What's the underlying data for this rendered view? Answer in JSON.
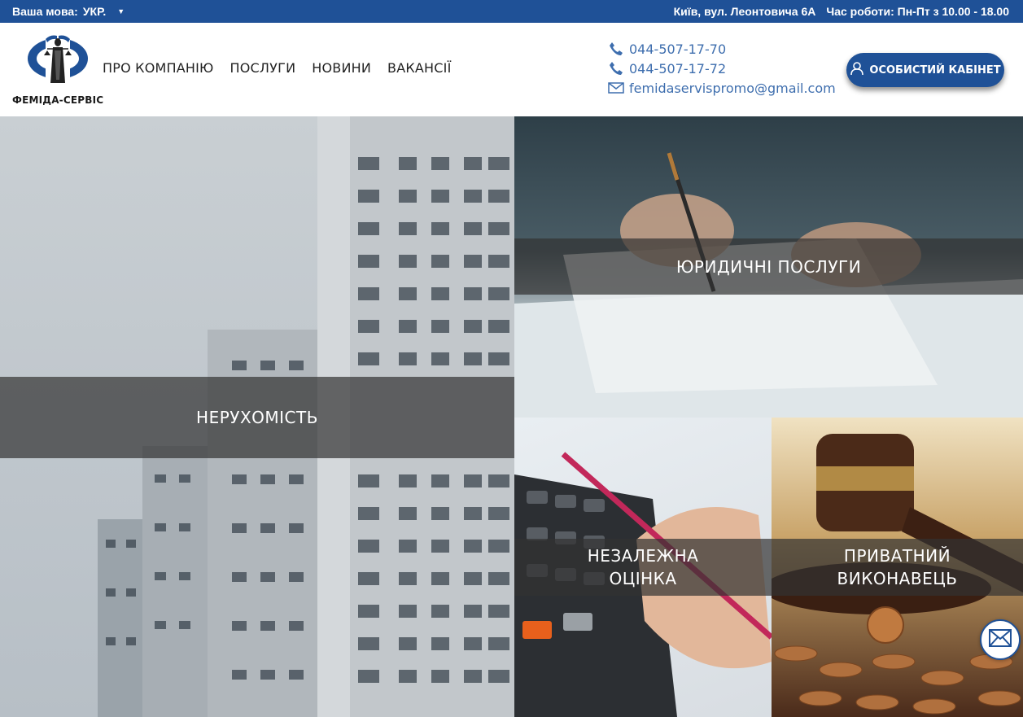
{
  "topbar": {
    "language_label": "Ваша мова:",
    "language_value": "УКР.",
    "address": "Київ, вул. Леонтовича 6А",
    "hours": "Час роботи: Пн-Пт з 10.00 - 18.00"
  },
  "header": {
    "brand": "ФЕМІДА-СЕРВІС",
    "nav": [
      "ПРО КОМПАНІЮ",
      "ПОСЛУГИ",
      "НОВИНИ",
      "ВАКАНСІЇ"
    ],
    "phones": [
      "044-507-17-70",
      "044-507-17-72"
    ],
    "email": "femidaservispromo@gmail.com",
    "cabinet_label": "ОСОБИСТИЙ КАБІНЕТ"
  },
  "tiles": {
    "real_estate": "НЕРУХОМІСТЬ",
    "legal": "ЮРИДИЧНІ ПОСЛУГИ",
    "evaluation_line1": "НЕЗАЛЕЖНА",
    "evaluation_line2": "ОЦІНКА",
    "executor_line1": "ПРИВАТНИЙ",
    "executor_line2": "ВИКОНАВЕЦЬ"
  },
  "icons": {
    "phone": "phone-icon",
    "mail": "mail-icon",
    "user": "user-icon",
    "caret": "caret-down-icon"
  },
  "colors": {
    "brand_blue": "#1f5197",
    "link_blue": "#3e6eae"
  }
}
